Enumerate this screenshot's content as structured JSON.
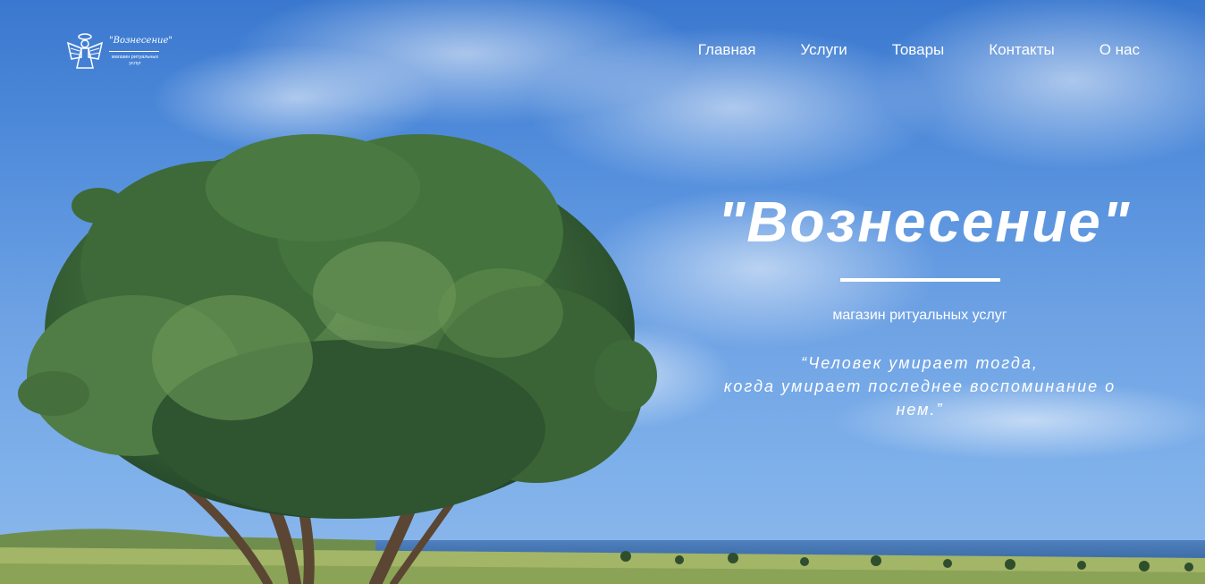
{
  "brand": {
    "name": "\"Вознесение\"",
    "tagline": "магазин ритуальных услуг"
  },
  "nav": {
    "items": [
      {
        "label": "Главная"
      },
      {
        "label": "Услуги"
      },
      {
        "label": "Товары"
      },
      {
        "label": "Контакты"
      },
      {
        "label": "О нас"
      }
    ]
  },
  "hero": {
    "title": "\"Вознесение\"",
    "subtitle": "магазин ритуальных услуг",
    "quote_lines": [
      "“Человек умирает тогда,",
      "когда умирает последнее воспоминание о",
      "нем.”"
    ]
  },
  "colors": {
    "sky_top": "#3a78cf",
    "sky_bottom": "#8db8ec",
    "text": "#ffffff",
    "foliage": "#3f6b3a",
    "sea": "#3b6fb0",
    "grass": "#a7b86a"
  },
  "icons": {
    "logo": "angel-icon"
  }
}
